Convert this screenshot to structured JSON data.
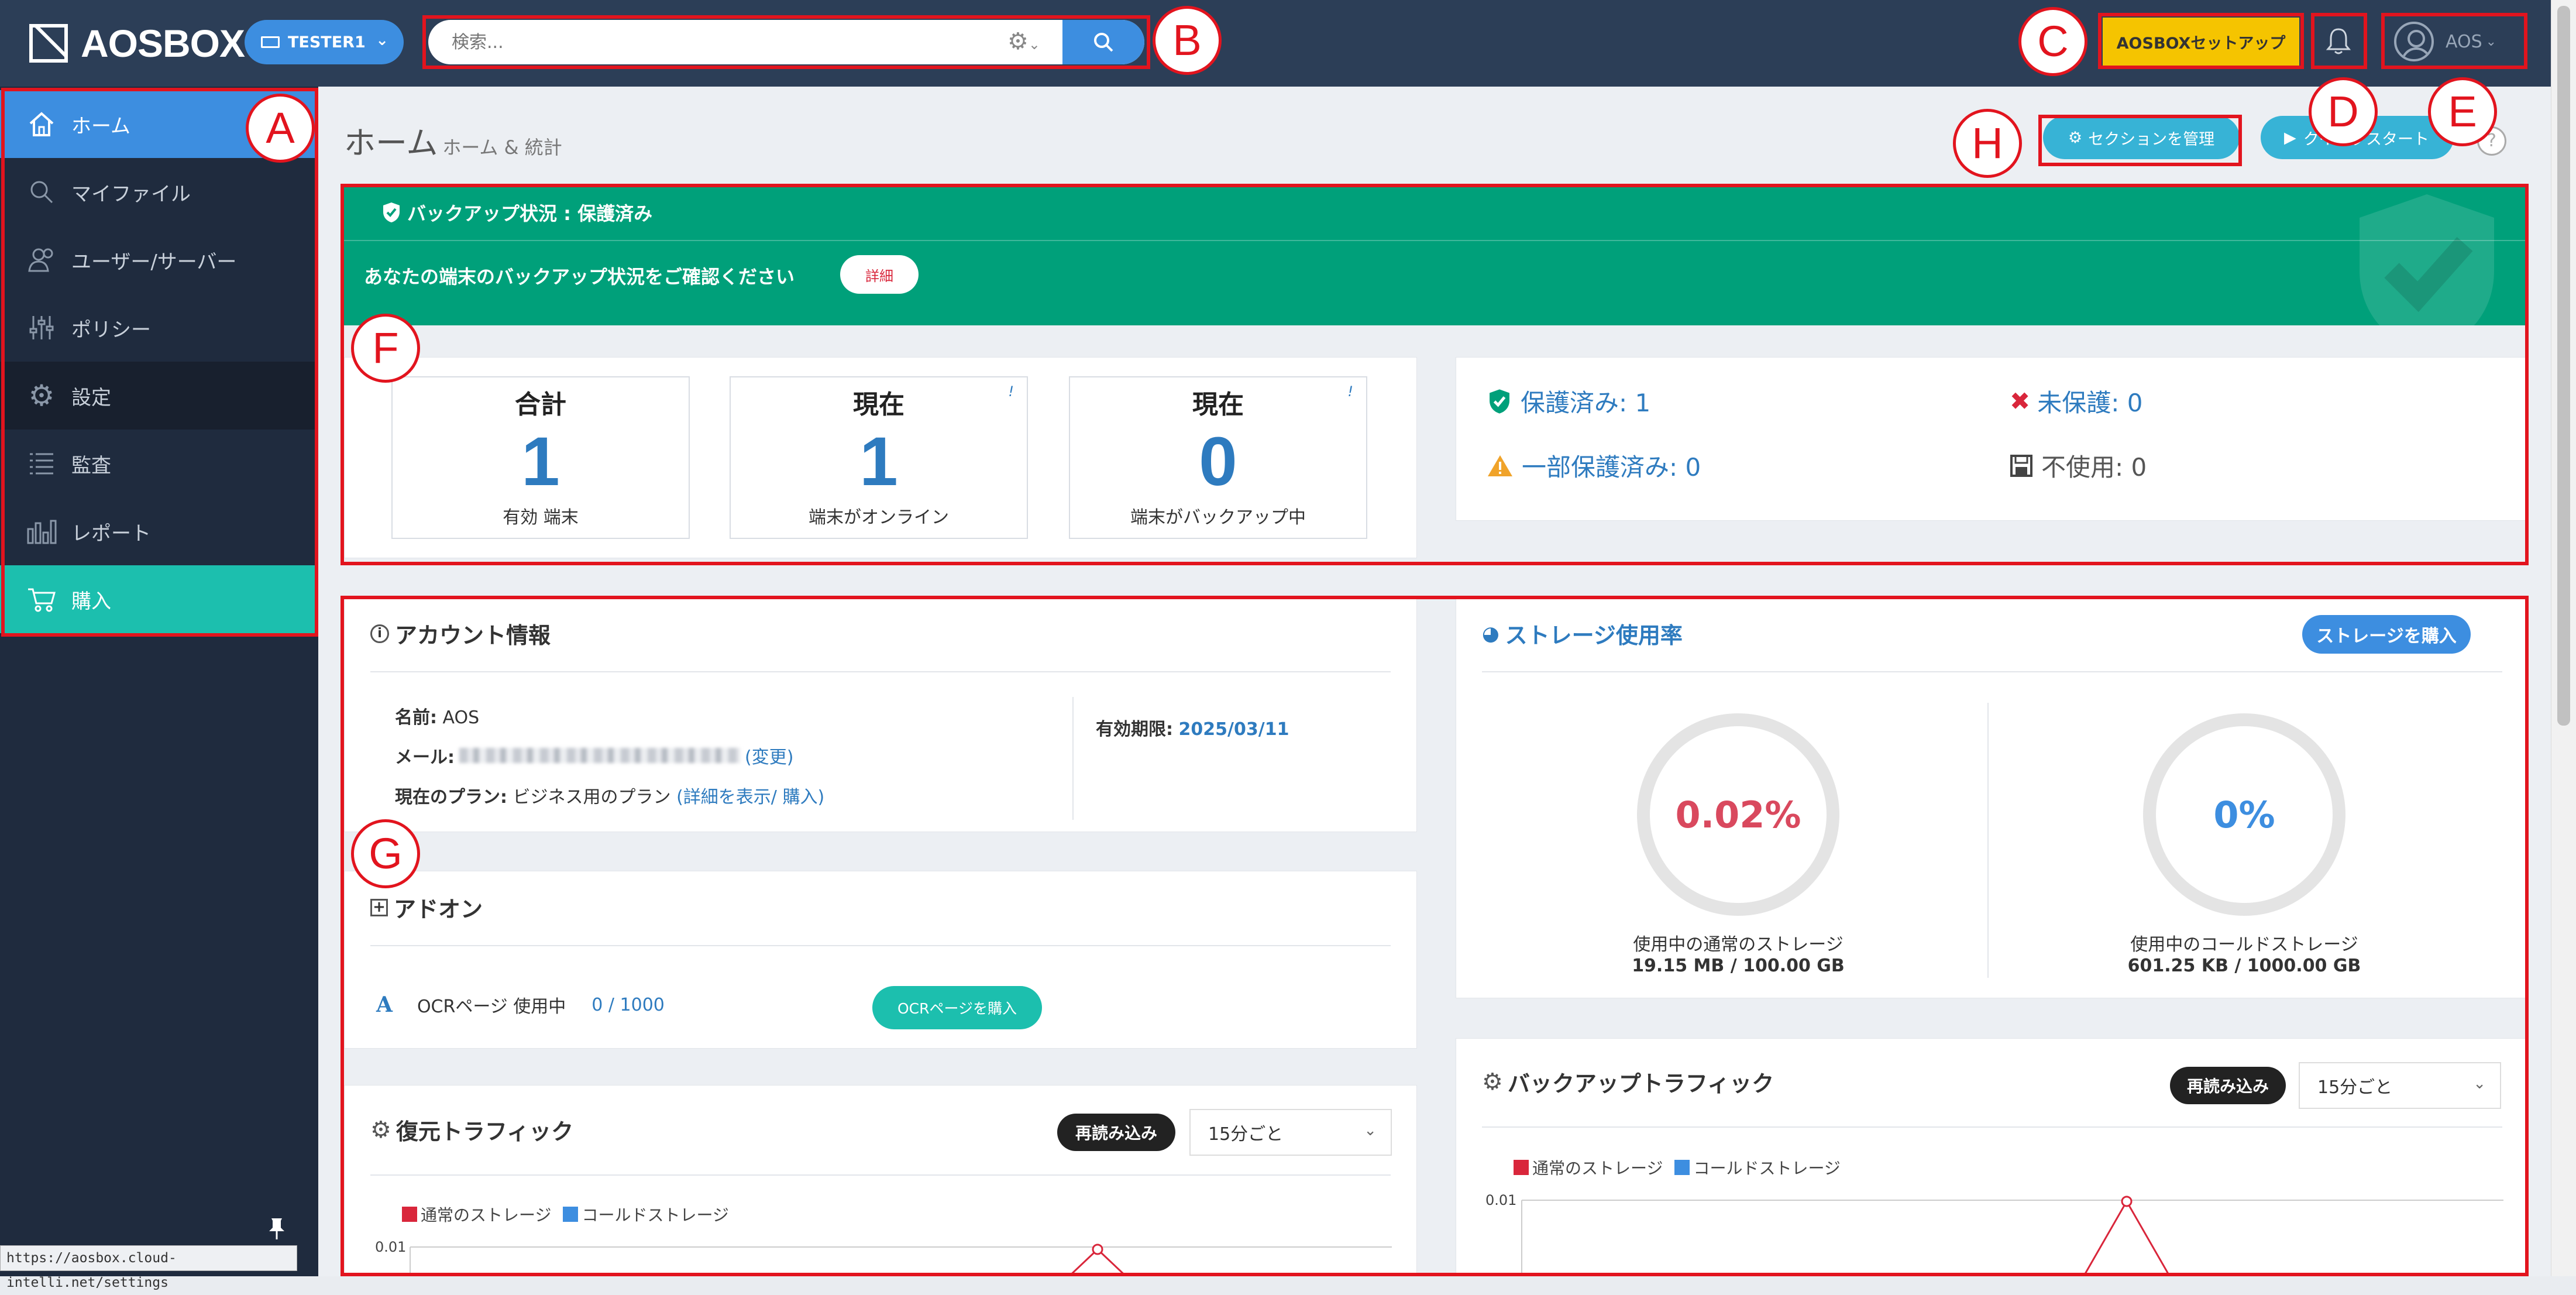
{
  "topbar": {
    "logo": "AOSBOX",
    "tenant": "TESTER1",
    "search_placeholder": "検索...",
    "setup_label": "AOSBOXセットアップ",
    "user_name": "AOS"
  },
  "sidebar": {
    "items": [
      {
        "label": "ホーム",
        "icon": "home-icon"
      },
      {
        "label": "マイファイル",
        "icon": "search-icon"
      },
      {
        "label": "ユーザー/サーバー",
        "icon": "users-icon"
      },
      {
        "label": "ポリシー",
        "icon": "sliders-icon"
      },
      {
        "label": "設定",
        "icon": "gear-icon"
      },
      {
        "label": "監査",
        "icon": "list-icon"
      },
      {
        "label": "レポート",
        "icon": "bar-chart-icon"
      },
      {
        "label": "購入",
        "icon": "cart-icon"
      }
    ],
    "status_url": "https://aosbox.cloud-intelli.net/settings"
  },
  "page": {
    "title": "ホーム",
    "subtitle": "ホーム & 統計",
    "section_button": "セクションを管理",
    "quickstart_button": "クイックスタート",
    "help": "?"
  },
  "backup_status": {
    "title": "バックアップ状況 : 保護済み",
    "message": "あなたの端末のバックアップ状況をご確認ください",
    "detail_button": "詳細"
  },
  "device_stats": [
    {
      "title": "合計",
      "value": "1",
      "caption": "有効 端末",
      "flag": ""
    },
    {
      "title": "現在",
      "value": "1",
      "caption": "端末がオンライン",
      "flag": "!"
    },
    {
      "title": "現在",
      "value": "0",
      "caption": "端末がバックアップ中",
      "flag": "!"
    }
  ],
  "protection": {
    "protected": "保護済み: 1",
    "unprotected": "未保護: 0",
    "partial": "一部保護済み: 0",
    "unused": "不使用: 0"
  },
  "account": {
    "heading": "アカウント情報",
    "name_label": "名前:",
    "name_value": "AOS",
    "email_label": "メール:",
    "email_change": "(変更)",
    "plan_label": "現在のプラン:",
    "plan_value": "ビジネス用のプラン",
    "plan_link": "(詳細を表示/ 購入)",
    "expiry_label": "有効期限:",
    "expiry_value": "2025/03/11"
  },
  "addons": {
    "heading": "アドオン",
    "ocr_label": "OCRページ 使用中",
    "ocr_value": "0 / 1000",
    "ocr_button": "OCRページを購入"
  },
  "storage": {
    "heading": "ストレージ使用率",
    "buy_button": "ストレージを購入",
    "standard_percent": "0.02%",
    "standard_label": "使用中の通常のストレージ",
    "standard_usage": "19.15 MB / 100.00 GB",
    "cold_percent": "0%",
    "cold_label": "使用中のコールドストレージ",
    "cold_usage": "601.25 KB / 1000.00 GB"
  },
  "restore_traffic": {
    "heading": "復元トラフィック",
    "reload_button": "再読み込み",
    "interval": "15分ごと",
    "legend_standard": "通常のストレージ",
    "legend_cold": "コールドストレージ",
    "ytick": "0.01"
  },
  "backup_traffic": {
    "heading": "バックアップトラフィック",
    "reload_button": "再読み込み",
    "interval": "15分ごと",
    "legend_standard": "通常のストレージ",
    "legend_cold": "コールドストレージ",
    "ytick": "0.01"
  },
  "callouts": {
    "A": "A",
    "B": "B",
    "C": "C",
    "D": "D",
    "E": "E",
    "F": "F",
    "G": "G",
    "H": "H"
  },
  "colors": {
    "accent": "#3d8ee0",
    "success": "#00a07a",
    "buy": "#1cbfae",
    "highlight": "#e2141e",
    "setup": "#f5c400"
  }
}
